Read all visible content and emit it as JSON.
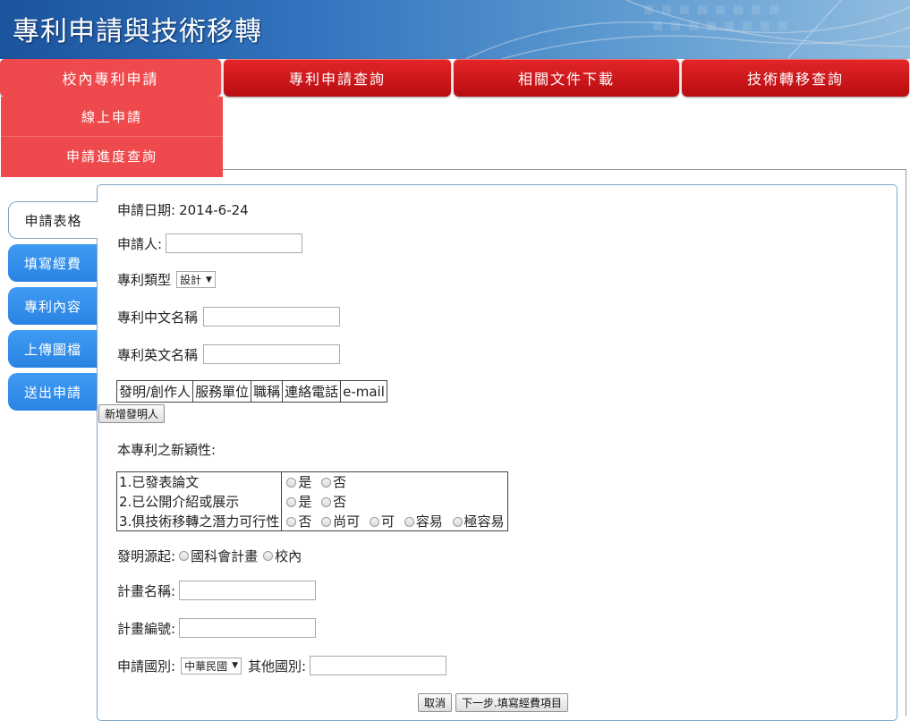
{
  "banner": {
    "title": "專利申請與技術移轉"
  },
  "nav": {
    "items": [
      {
        "label": "校內專利申請"
      },
      {
        "label": "專利申請查詢"
      },
      {
        "label": "相關文件下載"
      },
      {
        "label": "技術轉移查詢"
      }
    ]
  },
  "dropdown": {
    "items": [
      {
        "label": "線上申請"
      },
      {
        "label": "申請進度查詢"
      }
    ]
  },
  "side_tabs": [
    {
      "label": "申請表格"
    },
    {
      "label": "填寫經費"
    },
    {
      "label": "專利內容"
    },
    {
      "label": "上傳圖檔"
    },
    {
      "label": "送出申請"
    }
  ],
  "form": {
    "date_label": "申請日期:",
    "date_value": "2014-6-24",
    "applicant_label": "申請人:",
    "applicant_value": "",
    "patent_type_label": "專利類型",
    "patent_type_value": "設計",
    "cn_name_label": "專利中文名稱",
    "cn_name_value": "",
    "en_name_label": "專利英文名稱",
    "en_name_value": "",
    "inventor_columns": [
      "發明/創作人",
      "服務單位",
      "職稱",
      "連絡電話",
      "e-mail"
    ],
    "add_inventor_label": "新增發明人",
    "novelty_label": "本專利之新穎性:",
    "novelty_rows": [
      {
        "label": "1.已發表論文",
        "options": [
          "是",
          "否"
        ]
      },
      {
        "label": "2.已公開介紹或展示",
        "options": [
          "是",
          "否"
        ]
      },
      {
        "label": "3.俱技術移轉之潛力可行性",
        "options": [
          "否",
          "尚可",
          "可",
          "容易",
          "極容易"
        ]
      }
    ],
    "origin_label": "發明源起:",
    "origin_options": [
      "國科會計畫",
      "校內"
    ],
    "project_name_label": "計畫名稱:",
    "project_name_value": "",
    "project_no_label": "計畫編號:",
    "project_no_value": "",
    "country_label": "申請國別:",
    "country_value": "中華民國",
    "other_country_label": "其他國別:",
    "other_country_value": "",
    "cancel_label": "取消",
    "next_label": "下一步.填寫經費項目"
  }
}
